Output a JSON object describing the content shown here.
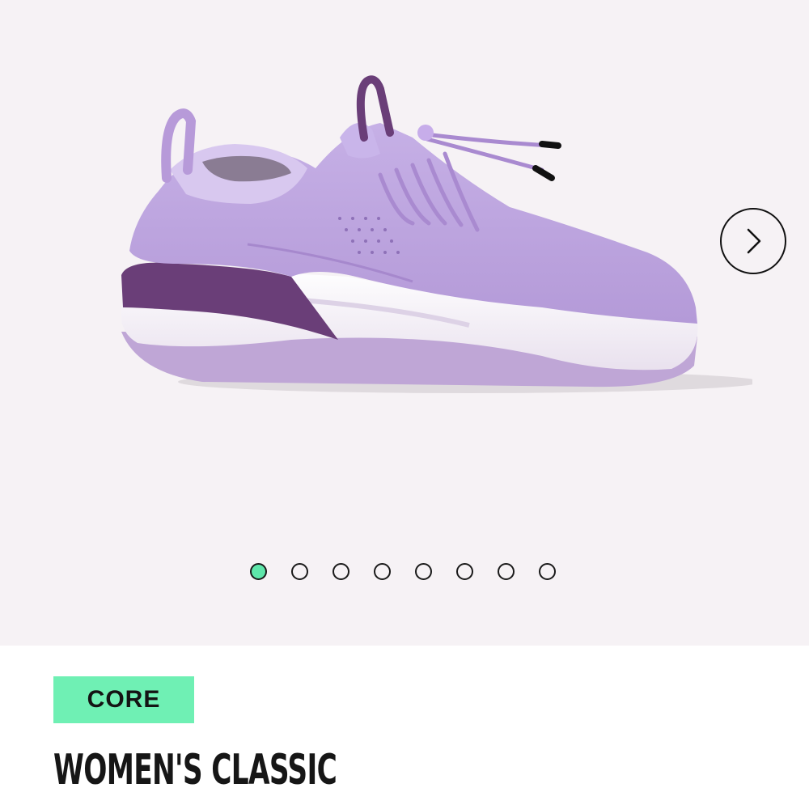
{
  "gallery": {
    "image_icon": "womens-classic-sneaker-image",
    "next_icon": "chevron-right-icon",
    "dots_total": 8,
    "active_dot": 1,
    "active_dot_color": "#5ee6aa",
    "background_color": "#f6f2f5"
  },
  "product": {
    "badge": "CORE",
    "badge_color": "#6ff0b4",
    "title": "WOMEN'S CLASSIC"
  }
}
